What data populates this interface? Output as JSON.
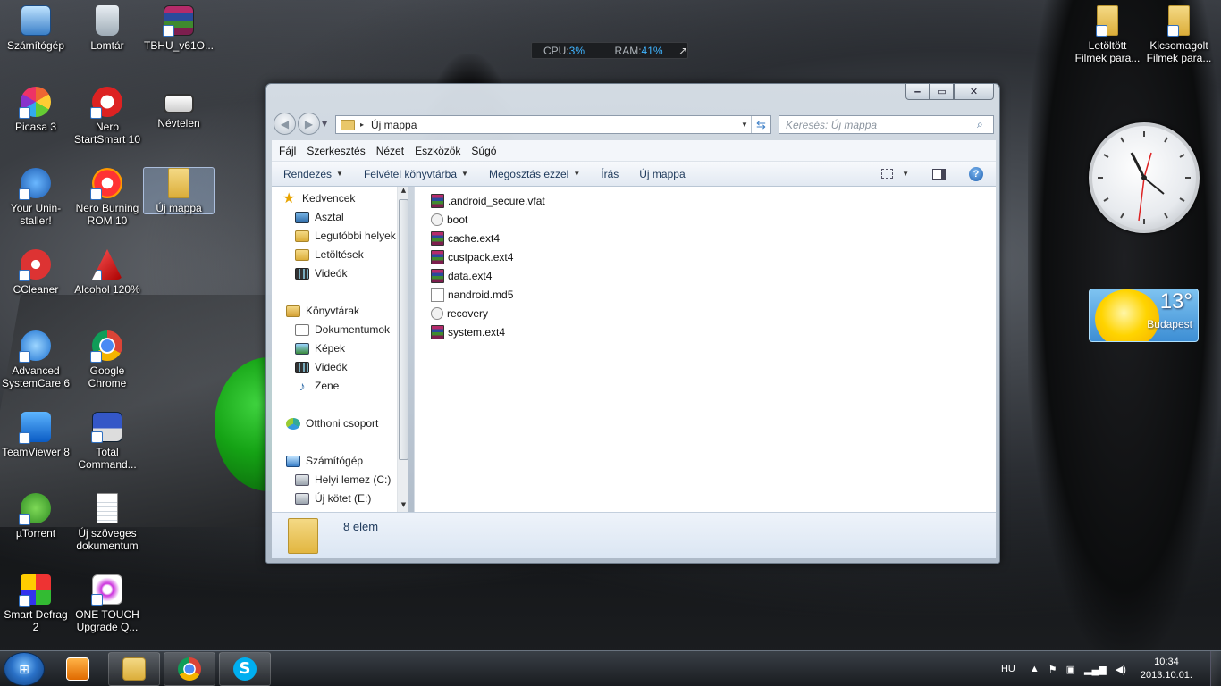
{
  "desktop": {
    "icons_left": [
      {
        "label": "Számítógép"
      },
      {
        "label": "Lomtár"
      },
      {
        "label": "TBHU_v61O..."
      },
      {
        "label": "Picasa 3"
      },
      {
        "label": "Nero StartSmart 10"
      },
      {
        "label": "Névtelen"
      },
      {
        "label": "Your Unin-staller!"
      },
      {
        "label": "Nero Burning ROM 10"
      },
      {
        "label": "Új mappa"
      },
      {
        "label": "CCleaner"
      },
      {
        "label": "Alcohol 120%"
      },
      {
        "label": "Advanced SystemCare 6"
      },
      {
        "label": "Google Chrome"
      },
      {
        "label": "TeamViewer 8"
      },
      {
        "label": "Total Command..."
      },
      {
        "label": "µTorrent"
      },
      {
        "label": "Új szöveges dokumentum"
      },
      {
        "label": "Smart Defrag 2"
      },
      {
        "label": "ONE TOUCH Upgrade Q..."
      }
    ],
    "icons_right": [
      {
        "label": "Letöltött Filmek para..."
      },
      {
        "label": "Kicsomagolt Filmek para..."
      }
    ]
  },
  "cpu_gadget": {
    "cpu_label": "CPU:",
    "cpu_value": "3%",
    "ram_label": "RAM:",
    "ram_value": "41%",
    "arrow": "↗"
  },
  "weather": {
    "temp": "13°",
    "city": "Budapest"
  },
  "window": {
    "controls": {
      "minimize": "‒",
      "maximize": "▭",
      "close": "✕"
    },
    "address": {
      "arrow": "▸",
      "path": "Új mappa"
    },
    "search": {
      "placeholder": "Keresés: Új mappa"
    },
    "menu": [
      "Fájl",
      "Szerkesztés",
      "Nézet",
      "Eszközök",
      "Súgó"
    ],
    "toolbar": [
      "Rendezés",
      "Felvétel könyvtárba",
      "Megosztás ezzel",
      "Írás",
      "Új mappa"
    ],
    "nav": {
      "favorites": "Kedvencek",
      "fav_items": [
        "Asztal",
        "Legutóbbi helyek",
        "Letöltések",
        "Videók"
      ],
      "libraries": "Könyvtárak",
      "lib_items": [
        "Dokumentumok",
        "Képek",
        "Videók",
        "Zene"
      ],
      "homegroup": "Otthoni csoport",
      "computer": "Számítógép",
      "drives": [
        "Helyi lemez (C:)",
        "Új kötet (E:)"
      ]
    },
    "files": [
      {
        "name": ".android_secure.vfat",
        "icon": "rar"
      },
      {
        "name": "boot",
        "icon": "gen"
      },
      {
        "name": "cache.ext4",
        "icon": "rar"
      },
      {
        "name": "custpack.ext4",
        "icon": "rar"
      },
      {
        "name": "data.ext4",
        "icon": "rar"
      },
      {
        "name": "nandroid.md5",
        "icon": "txt"
      },
      {
        "name": "recovery",
        "icon": "gen"
      },
      {
        "name": "system.ext4",
        "icon": "rar"
      }
    ],
    "details": {
      "count": "8 elem"
    }
  },
  "taskbar": {
    "lang": "HU",
    "time": "10:34",
    "date": "2013.10.01."
  }
}
